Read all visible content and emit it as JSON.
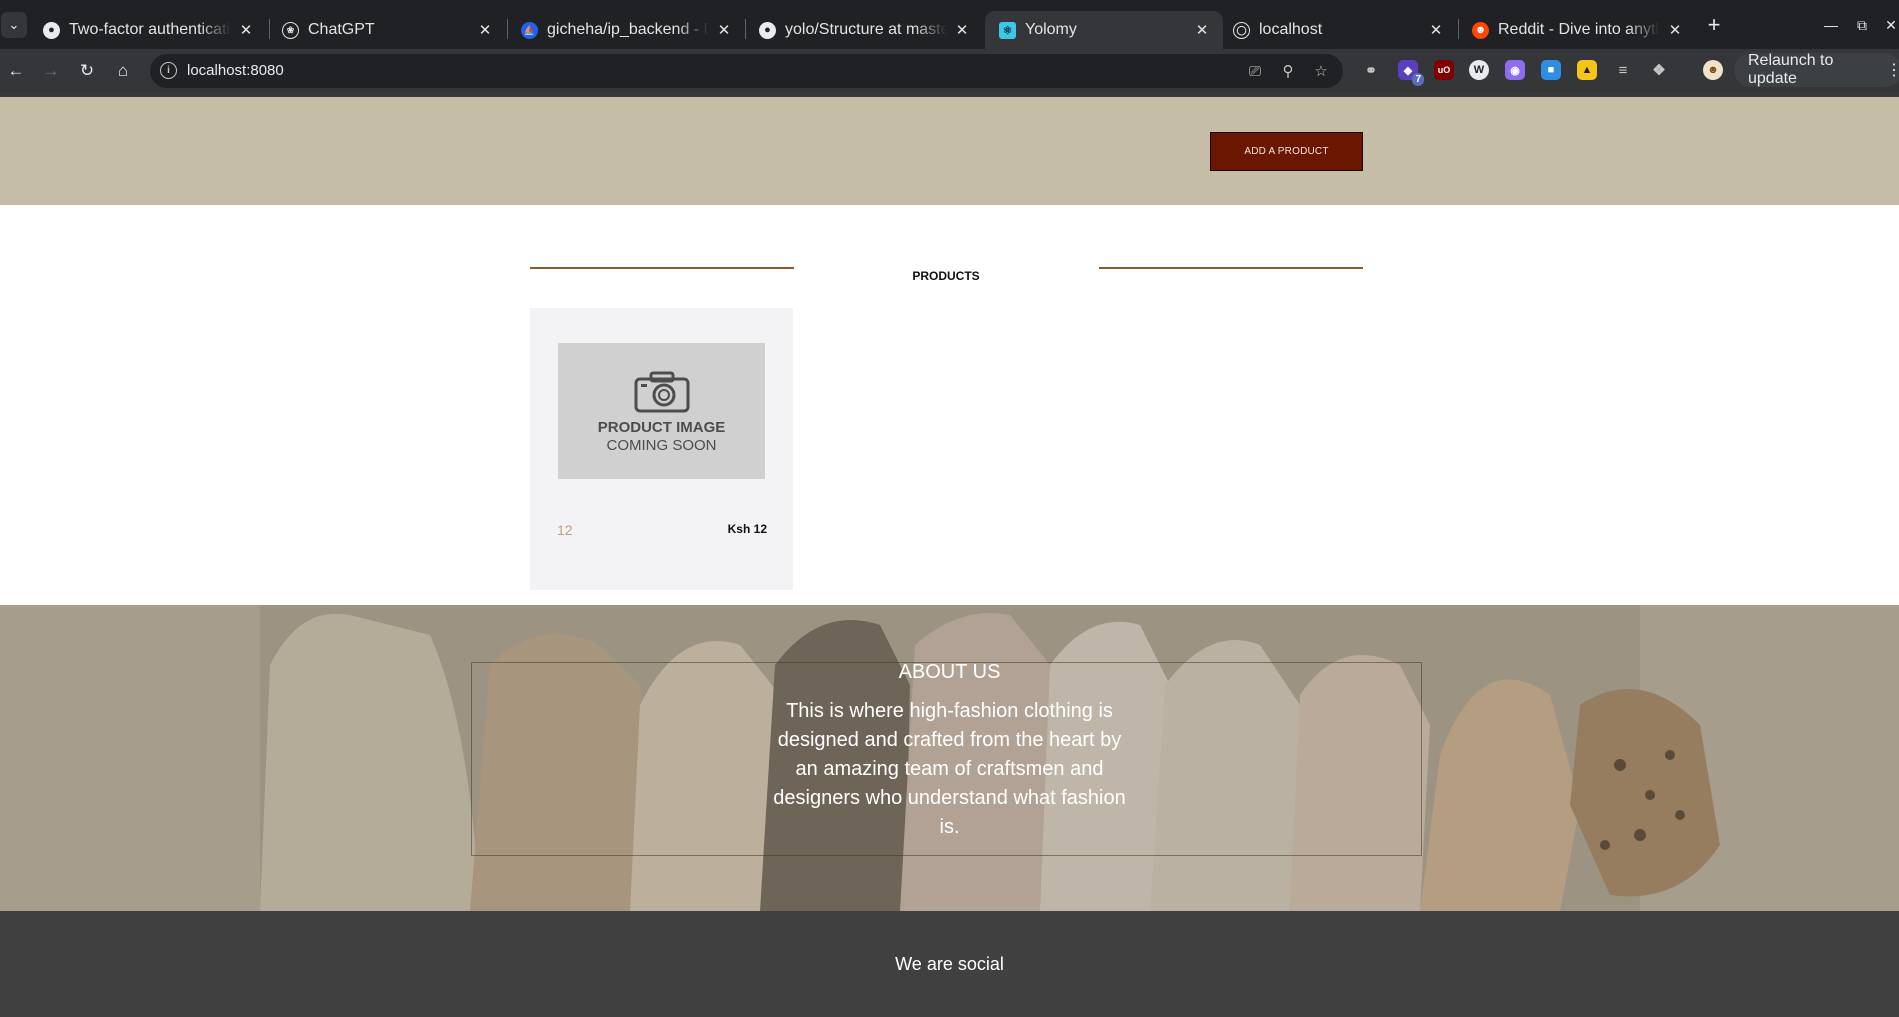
{
  "browser": {
    "tabs": [
      {
        "title": "Two-factor authenticatio",
        "icon": "github-icon"
      },
      {
        "title": "ChatGPT",
        "icon": "openai-icon"
      },
      {
        "title": "gicheha/ip_backend - Do",
        "icon": "docker-icon"
      },
      {
        "title": "yolo/Structure at master",
        "icon": "github-icon"
      },
      {
        "title": "Yolomy",
        "icon": "react-icon",
        "active": true
      },
      {
        "title": "localhost",
        "icon": "globe-icon"
      },
      {
        "title": "Reddit - Dive into anythi",
        "icon": "reddit-icon"
      }
    ],
    "url": "localhost:8080",
    "extension_badge": "7",
    "ext_ublock_label": "uO",
    "relaunch_label": "Relaunch to update"
  },
  "header": {
    "add_product_label": "ADD A PRODUCT"
  },
  "products": {
    "heading": "PRODUCTS",
    "items": [
      {
        "image_line1": "PRODUCT IMAGE",
        "image_line2": "COMING SOON",
        "name": "12",
        "price": "Ksh 12"
      }
    ]
  },
  "about": {
    "title": "ABOUT US",
    "text": "This is where high-fashion clothing is designed and crafted from the heart by an amazing team of craftsmen and designers who understand what fashion is."
  },
  "social": {
    "title": "We are social"
  },
  "colors": {
    "hero_bg": "#c5bda5",
    "add_button_bg": "#6b1600",
    "rule": "#8b5a2b",
    "card_bg": "#f3f3f5",
    "price_name": "#c0a17a",
    "footer_bg": "#404040"
  }
}
